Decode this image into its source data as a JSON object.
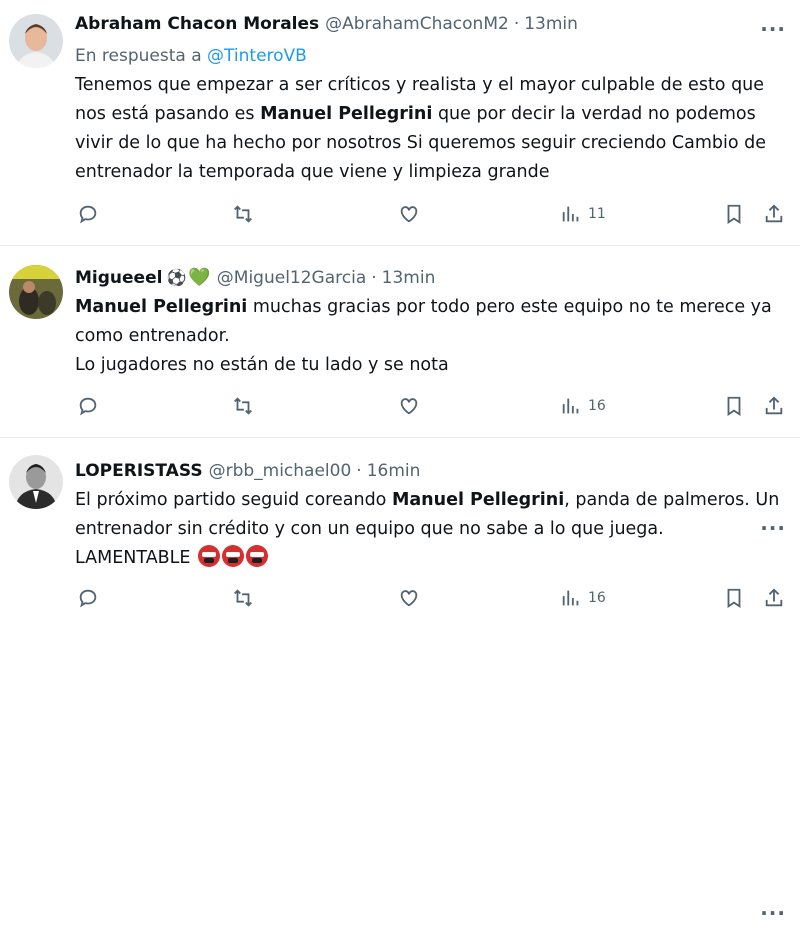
{
  "tweets": [
    {
      "name": "Abraham Chacon Morales",
      "handle": "@AbrahamChaconM2",
      "dot": "·",
      "time": "13min",
      "replying_prefix": "En respuesta a",
      "replying_to": "@TinteroVB",
      "text_before": "Tenemos que empezar a ser críticos y realista y el mayor culpable de esto que nos está pasando es ",
      "bold": "Manuel Pellegrini",
      "text_after": " que por decir la verdad no podemos vivir de lo que ha hecho por nosotros Si queremos seguir creciendo Cambio de entrenador la temporada que viene y limpieza grande",
      "views": "11"
    },
    {
      "name": "Migueeel",
      "name_emoji": "⚽",
      "name_heart": "💚",
      "handle": "@Miguel12Garcia",
      "dot": "·",
      "time": "13min",
      "bold": "Manuel Pellegrini",
      "text_after_line1": " muchas gracias por todo pero este equipo no te merece ya como entrenador.",
      "text_line2": "Lo jugadores no están de tu lado y se nota",
      "views": "16"
    },
    {
      "name": "LOPERISTASS",
      "handle": "@rbb_michael00",
      "dot": "·",
      "time": "16min",
      "text_before": "El próximo partido seguid coreando ",
      "bold": "Manuel Pellegrini",
      "text_after": ", panda de palmeros. Un entrenador sin crédito y con un equipo que no sabe a lo que juega.",
      "text_line3": "LAMENTABLE",
      "views": "16"
    }
  ],
  "more_label": "···",
  "icons": {
    "reply": "reply-icon",
    "retweet": "retweet-icon",
    "like": "like-icon",
    "views": "views-icon",
    "bookmark": "bookmark-icon",
    "share": "share-icon",
    "rage": "rage-face-icon"
  },
  "colors": {
    "link": "#1d9bf0",
    "secondary_text": "#536471",
    "primary_text": "#0f1419",
    "divider": "#e6e9ec"
  }
}
